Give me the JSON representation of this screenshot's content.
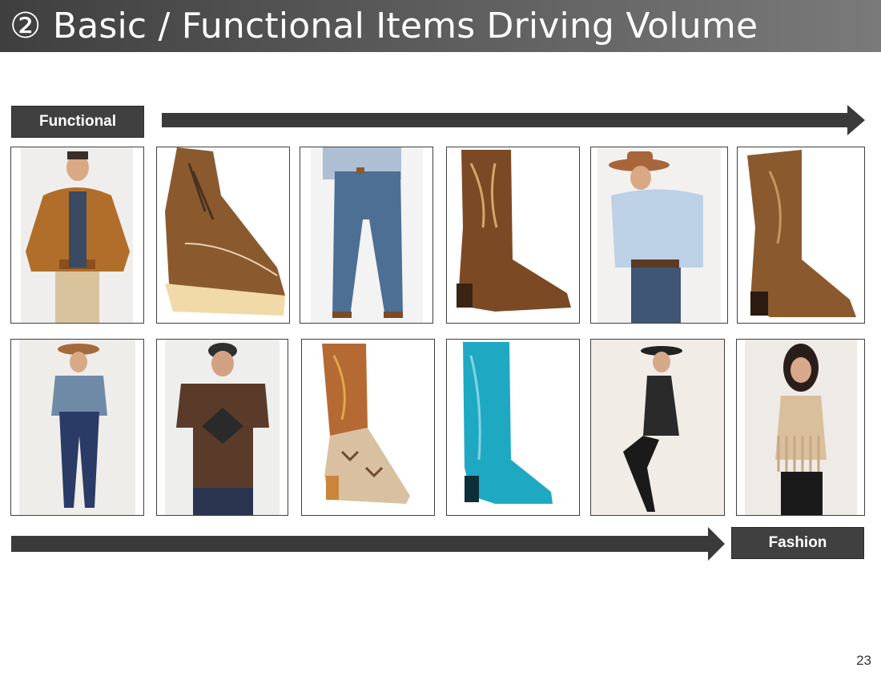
{
  "slide": {
    "title": "② Basic / Functional Items Driving Volume",
    "page_number": "23"
  },
  "labels": {
    "start": "Functional",
    "end": "Fashion"
  },
  "colors": {
    "header_dark": "#3f3f3f",
    "box": "#404040",
    "arrow": "#3a3a3a"
  },
  "products": {
    "row1": [
      "work-jacket-photo",
      "work-boot-photo",
      "jeans-photo",
      "brown-western-boot-photo",
      "cowboy-shirt-photo",
      "tall-brown-boot-photo"
    ],
    "row2": [
      "denim-cowgirl-photo",
      "graphic-tee-photo",
      "snakeskin-boot-photo",
      "turquoise-boot-photo",
      "sequin-dress-photo",
      "fringe-top-photo"
    ]
  }
}
